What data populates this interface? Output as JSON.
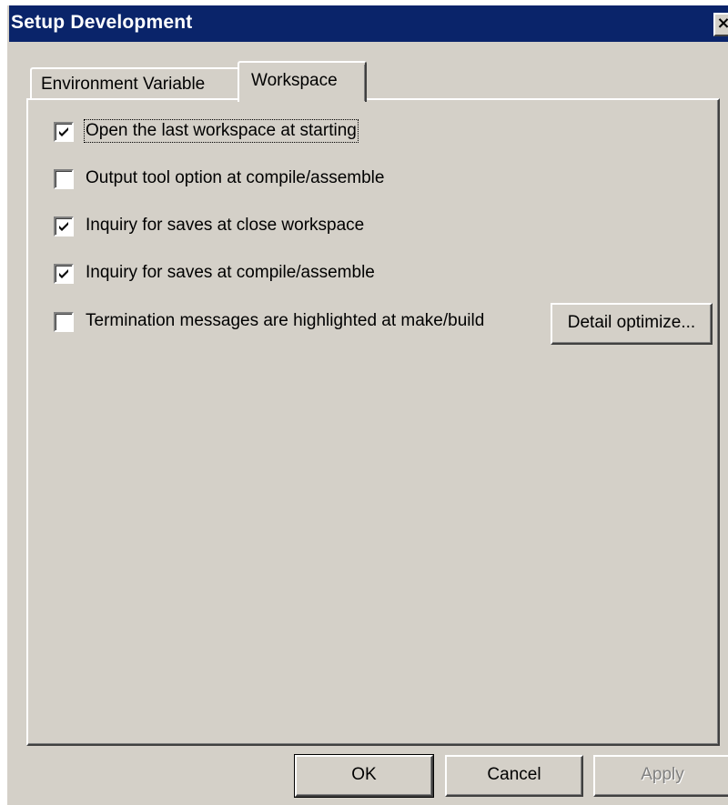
{
  "window": {
    "title": "Setup Development",
    "close_glyph": "×"
  },
  "tabs": [
    {
      "label": "Environment Variable",
      "selected": false
    },
    {
      "label": "Workspace",
      "selected": true
    }
  ],
  "workspace": {
    "options": [
      {
        "label": "Open the last workspace at starting",
        "checked": true
      },
      {
        "label": "Output tool option at compile/assemble",
        "checked": false
      },
      {
        "label": "Inquiry for saves at close workspace",
        "checked": true
      },
      {
        "label": "Inquiry for saves at compile/assemble",
        "checked": true
      },
      {
        "label": "Termination messages are highlighted at make/build",
        "checked": false
      }
    ],
    "detail_button": "Detail optimize..."
  },
  "buttons": {
    "ok": "OK",
    "cancel": "Cancel",
    "apply": "Apply"
  },
  "icons": {
    "close": "close-icon",
    "check": "check-icon"
  }
}
